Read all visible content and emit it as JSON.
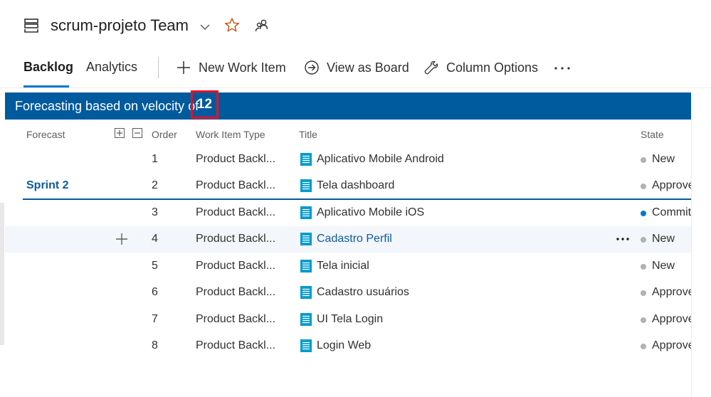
{
  "header": {
    "team_name": "scrum-projeto Team",
    "icons": [
      "backlog-board-icon",
      "chevron-down-icon",
      "star-icon",
      "team-members-icon"
    ]
  },
  "tabs": [
    {
      "label": "Backlog",
      "active": true
    },
    {
      "label": "Analytics",
      "active": false
    }
  ],
  "toolbar": {
    "new_work_item": "New Work Item",
    "view_as_board": "View as Board",
    "column_options": "Column Options",
    "more_icon": "more-actions-icon"
  },
  "forecast": {
    "banner_text": "Forecasting based on velocity of",
    "velocity": "12"
  },
  "columns": {
    "forecast": "Forecast",
    "order": "Order",
    "work_item_type": "Work Item Type",
    "title": "Title",
    "state": "State"
  },
  "sprint": {
    "label": "Sprint 2"
  },
  "rows": [
    {
      "order": "1",
      "type": "Product Backl...",
      "title": "Aplicativo Mobile Android",
      "state": "New"
    },
    {
      "order": "2",
      "type": "Product Backl...",
      "title": "Tela dashboard",
      "state": "Approved"
    },
    {
      "order": "3",
      "type": "Product Backl...",
      "title": "Aplicativo Mobile iOS",
      "state": "Committed"
    },
    {
      "order": "4",
      "type": "Product Backl...",
      "title": "Cadastro Perfil",
      "state": "New"
    },
    {
      "order": "5",
      "type": "Product Backl...",
      "title": "Tela inicial",
      "state": "New"
    },
    {
      "order": "6",
      "type": "Product Backl...",
      "title": "Cadastro usuários",
      "state": "Approved"
    },
    {
      "order": "7",
      "type": "Product Backl...",
      "title": "UI Tela Login",
      "state": "Approved"
    },
    {
      "order": "8",
      "type": "Product Backl...",
      "title": "Login Web",
      "state": "Approved"
    }
  ],
  "colors": {
    "accent": "#0078d4",
    "banner": "#005a9e",
    "highlight_box": "#e81123",
    "work_item_icon": "#009ccc",
    "state_new": "#b2b2b2",
    "state_committed": "#0078d4"
  }
}
